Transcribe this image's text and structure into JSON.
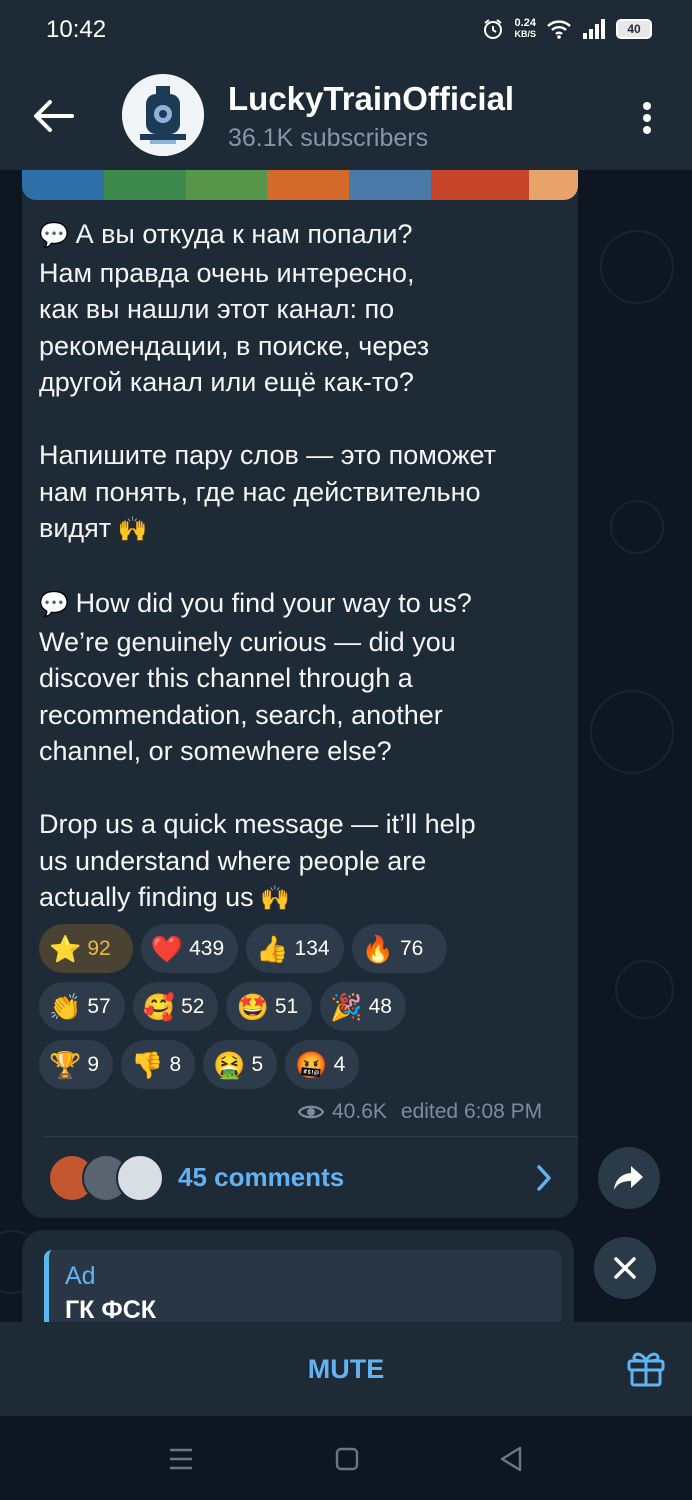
{
  "status_bar": {
    "time": "10:42",
    "net_speed_value": "0.24",
    "net_speed_unit": "KB/S",
    "battery": "40"
  },
  "header": {
    "title": "LuckyTrainOfficial",
    "subtitle": "36.1K subscribers"
  },
  "message": {
    "paragraphs": [
      "А вы откуда к нам попали?\nНам правда очень интересно,\nкак вы нашли этот канал: по\nрекомендации, в поиске, через\nдругой канал или ещё как-то?",
      "Напишите пару слов — это поможет\nнам понять, где нас действительно\nвидят",
      "How did you find your way to us?\nWe’re genuinely curious — did you\ndiscover this channel through a\nrecommendation, search, another\nchannel, or somewhere else?",
      "Drop us a quick message — it’ll help\nus understand where people are\nactually finding us"
    ],
    "views": "40.6K",
    "edited": "edited 6:08 PM"
  },
  "reactions": [
    {
      "emoji": "⭐",
      "count": "92",
      "icon": "star-icon"
    },
    {
      "emoji": "❤️",
      "count": "439",
      "icon": "heart-icon"
    },
    {
      "emoji": "👍",
      "count": "134",
      "icon": "thumbs-up-icon"
    },
    {
      "emoji": "🔥",
      "count": "76",
      "icon": "fire-icon"
    },
    {
      "emoji": "👏",
      "count": "57",
      "icon": "clap-icon"
    },
    {
      "emoji": "🥰",
      "count": "52",
      "icon": "smiling-hearts-icon"
    },
    {
      "emoji": "🤩",
      "count": "51",
      "icon": "star-struck-icon"
    },
    {
      "emoji": "🎉",
      "count": "48",
      "icon": "party-popper-icon"
    },
    {
      "emoji": "🏆",
      "count": "9",
      "icon": "trophy-icon"
    },
    {
      "emoji": "👎",
      "count": "8",
      "icon": "thumbs-down-icon"
    },
    {
      "emoji": "🤮",
      "count": "5",
      "icon": "vomit-icon"
    },
    {
      "emoji": "🤬",
      "count": "4",
      "icon": "cursing-face-icon"
    }
  ],
  "comments": {
    "label": "45 comments"
  },
  "ad": {
    "tag": "Ad",
    "title": "ГК ФСК"
  },
  "bottom_bar": {
    "mute_label": "MUTE"
  },
  "colors": {
    "accent": "#62b3f2",
    "bubble": "#1f2a37",
    "background": "#0e1621",
    "star_reaction": "#e8b94a"
  }
}
